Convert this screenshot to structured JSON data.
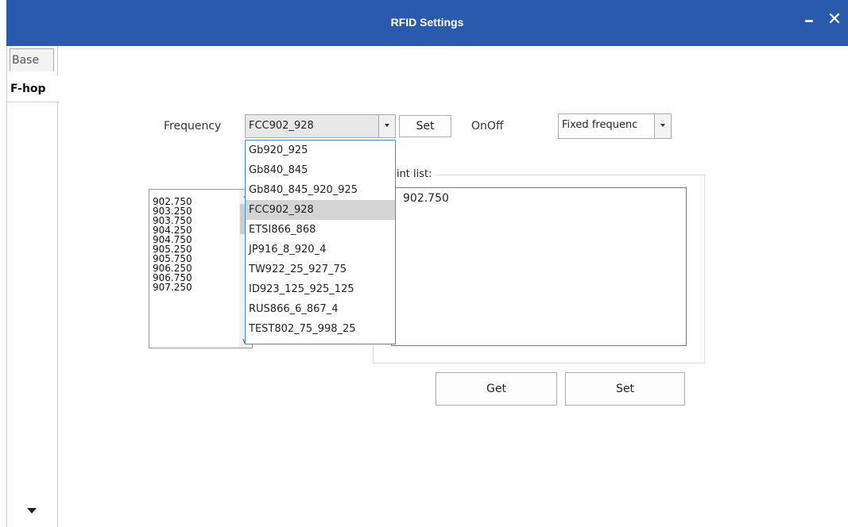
{
  "window": {
    "title": "RFID Settings",
    "minimize_icon": "minus-icon",
    "close_icon": "close-icon"
  },
  "tabs": [
    {
      "label": "Base",
      "active": false
    },
    {
      "label": "F-hop",
      "active": true
    }
  ],
  "frequency": {
    "label": "Frequency",
    "selected": "FCC902_928",
    "set_label": "Set",
    "options": [
      "Gb920_925",
      "Gb840_845",
      "Gb840_845_920_925",
      "FCC902_928",
      "ETSI866_868",
      "JP916_8_920_4",
      "TW922_25_927_75",
      "ID923_125_925_125",
      "RUS866_6_867_4",
      "TEST802_75_998_25"
    ]
  },
  "onoff": {
    "label": "OnOff",
    "selected": "Fixed frequenc"
  },
  "freq_list": [
    "902.750",
    "903.250",
    "903.750",
    "904.250",
    "904.750",
    "905.250",
    "905.750",
    "906.250",
    "906.750",
    "907.250"
  ],
  "point_list": {
    "label": "oint list:",
    "value": "902.750"
  },
  "actions": {
    "get_label": "Get",
    "set_label": "Set"
  }
}
